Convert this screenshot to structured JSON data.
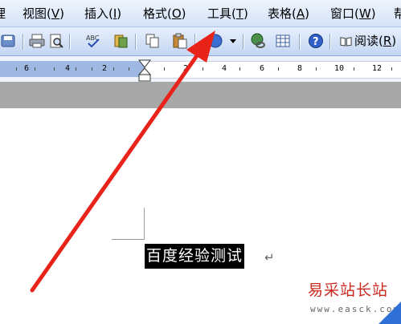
{
  "menu": [
    {
      "text": "理",
      "acc": ""
    },
    {
      "text": "视图(",
      "acc": "V",
      "tail": ")"
    },
    {
      "text": "插入(",
      "acc": "I",
      "tail": ")"
    },
    {
      "text": "格式(",
      "acc": "O",
      "tail": ")"
    },
    {
      "text": "工具(",
      "acc": "T",
      "tail": ")"
    },
    {
      "text": "表格(",
      "acc": "A",
      "tail": ")"
    },
    {
      "text": "窗口(",
      "acc": "W",
      "tail": ")"
    },
    {
      "text": "帮",
      "acc": ""
    }
  ],
  "toolbar": {
    "read_label_pre": "阅读(",
    "read_acc": "R",
    "read_tail": ")",
    "icons": [
      "save-icon",
      "print-icon",
      "print-preview-icon",
      "spelling-icon",
      "research-icon",
      "copy-icon",
      "paste-icon",
      "undo-icon",
      "dropdown-arrow-icon",
      "hyperlink-icon",
      "table-icon",
      "help-icon",
      "read-icon"
    ]
  },
  "ruler": {
    "numbers": [
      "6",
      "4",
      "2",
      "2",
      "4",
      "6",
      "8",
      "10",
      "12"
    ]
  },
  "document": {
    "selected_text": "百度经验测试",
    "para_mark": "↵"
  },
  "watermark": {
    "title": "易采站长站",
    "url": "www.easck.com"
  },
  "colors": {
    "arrow": "#e8231a",
    "menubar": "#d4e2f8",
    "selection": "#000000"
  }
}
